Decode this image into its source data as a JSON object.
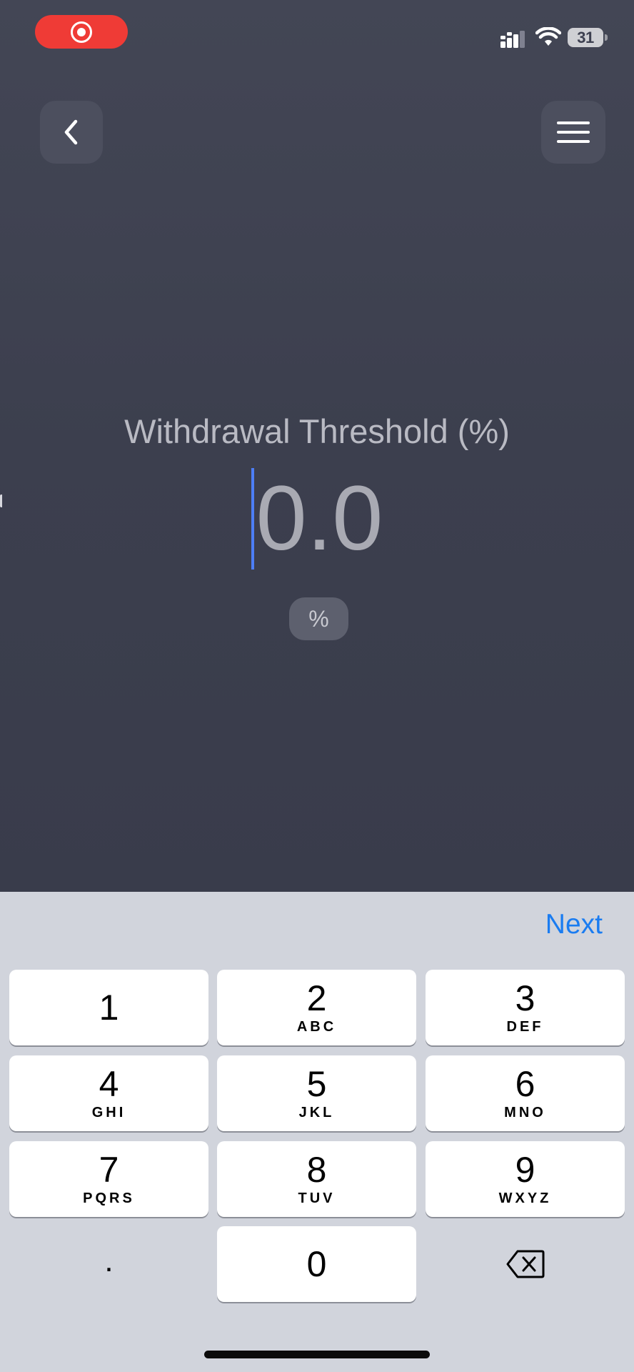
{
  "status_bar": {
    "recording_icon": "screen-recording-icon",
    "signal_icon": "cellular-signal-icon",
    "wifi_icon": "wifi-icon",
    "battery_level": "31"
  },
  "header": {
    "back_icon": "chevron-left-icon",
    "menu_icon": "hamburger-menu-icon"
  },
  "threshold": {
    "label": "Withdrawal Threshold (%)",
    "value": "0.0",
    "unit": "%"
  },
  "keyboard": {
    "next_label": "Next",
    "keys": [
      {
        "digit": "1",
        "letters": ""
      },
      {
        "digit": "2",
        "letters": "ABC"
      },
      {
        "digit": "3",
        "letters": "DEF"
      },
      {
        "digit": "4",
        "letters": "GHI"
      },
      {
        "digit": "5",
        "letters": "JKL"
      },
      {
        "digit": "6",
        "letters": "MNO"
      },
      {
        "digit": "7",
        "letters": "PQRS"
      },
      {
        "digit": "8",
        "letters": "TUV"
      },
      {
        "digit": "9",
        "letters": "WXYZ"
      },
      {
        "digit": "0",
        "letters": ""
      }
    ],
    "decimal_key": ".",
    "delete_icon": "backspace-icon"
  },
  "colors": {
    "background": "#3b3e4d",
    "accent": "#1a7cf1",
    "caret": "#4d7ef6",
    "record": "#ef3b36"
  }
}
